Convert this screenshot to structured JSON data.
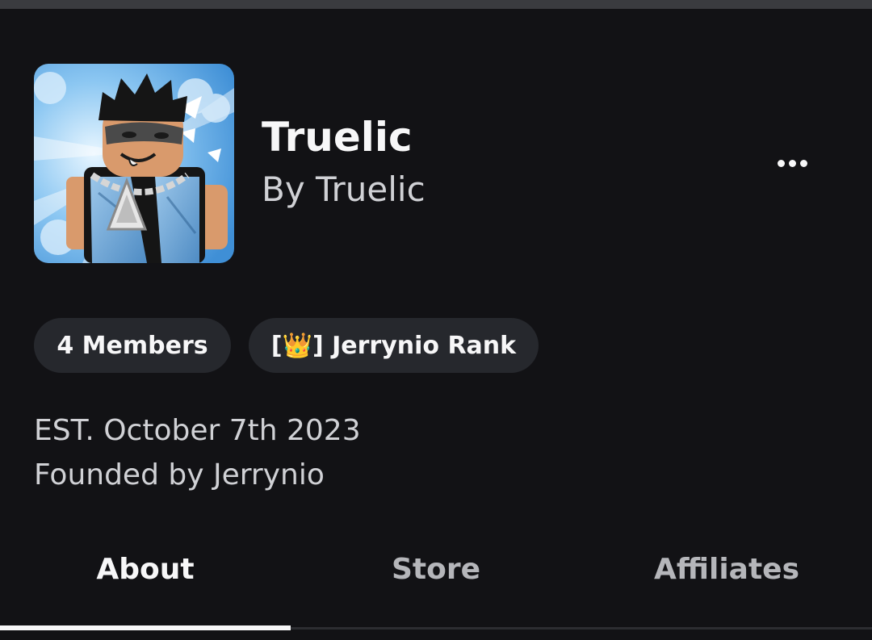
{
  "group": {
    "name": "Truelic",
    "owner_line": "By Truelic",
    "established": "EST. October 7th 2023",
    "founded_by": "Founded by Jerrynio"
  },
  "pills": {
    "members": "4 Members",
    "rank": "[👑] Jerrynio Rank"
  },
  "menu": {
    "icon": "more-horizontal-icon"
  },
  "tabs": [
    {
      "label": "About",
      "selected": true
    },
    {
      "label": "Store",
      "selected": false
    },
    {
      "label": "Affiliates",
      "selected": false
    }
  ],
  "colors": {
    "background": "#121215",
    "pill_background": "#26282d",
    "primary_text": "#f7f7f8",
    "secondary_text": "#d0d1d5",
    "inactive_tab_text": "#b5b6ba"
  }
}
